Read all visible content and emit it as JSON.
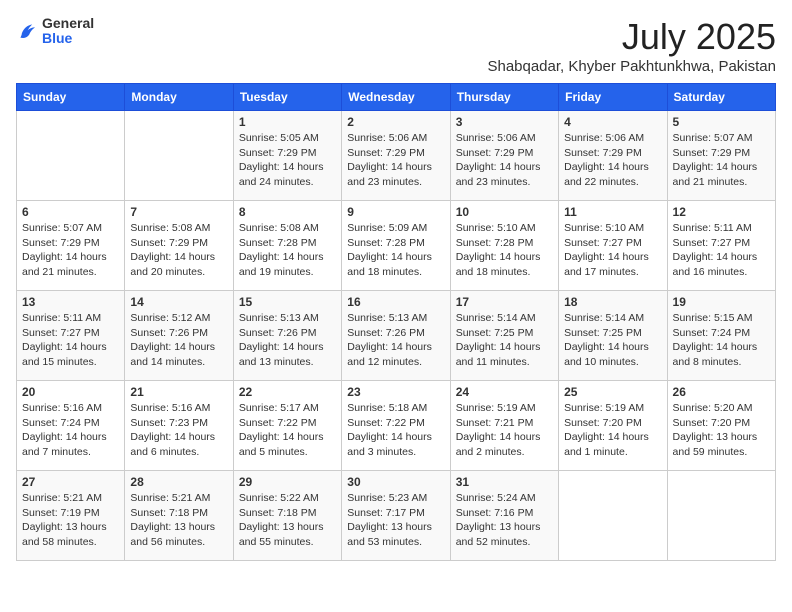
{
  "logo": {
    "general": "General",
    "blue": "Blue"
  },
  "header": {
    "month": "July 2025",
    "location": "Shabqadar, Khyber Pakhtunkhwa, Pakistan"
  },
  "weekdays": [
    "Sunday",
    "Monday",
    "Tuesday",
    "Wednesday",
    "Thursday",
    "Friday",
    "Saturday"
  ],
  "weeks": [
    [
      {
        "day": "",
        "sunrise": "",
        "sunset": "",
        "daylight": ""
      },
      {
        "day": "",
        "sunrise": "",
        "sunset": "",
        "daylight": ""
      },
      {
        "day": "1",
        "sunrise": "Sunrise: 5:05 AM",
        "sunset": "Sunset: 7:29 PM",
        "daylight": "Daylight: 14 hours and 24 minutes."
      },
      {
        "day": "2",
        "sunrise": "Sunrise: 5:06 AM",
        "sunset": "Sunset: 7:29 PM",
        "daylight": "Daylight: 14 hours and 23 minutes."
      },
      {
        "day": "3",
        "sunrise": "Sunrise: 5:06 AM",
        "sunset": "Sunset: 7:29 PM",
        "daylight": "Daylight: 14 hours and 23 minutes."
      },
      {
        "day": "4",
        "sunrise": "Sunrise: 5:06 AM",
        "sunset": "Sunset: 7:29 PM",
        "daylight": "Daylight: 14 hours and 22 minutes."
      },
      {
        "day": "5",
        "sunrise": "Sunrise: 5:07 AM",
        "sunset": "Sunset: 7:29 PM",
        "daylight": "Daylight: 14 hours and 21 minutes."
      }
    ],
    [
      {
        "day": "6",
        "sunrise": "Sunrise: 5:07 AM",
        "sunset": "Sunset: 7:29 PM",
        "daylight": "Daylight: 14 hours and 21 minutes."
      },
      {
        "day": "7",
        "sunrise": "Sunrise: 5:08 AM",
        "sunset": "Sunset: 7:29 PM",
        "daylight": "Daylight: 14 hours and 20 minutes."
      },
      {
        "day": "8",
        "sunrise": "Sunrise: 5:08 AM",
        "sunset": "Sunset: 7:28 PM",
        "daylight": "Daylight: 14 hours and 19 minutes."
      },
      {
        "day": "9",
        "sunrise": "Sunrise: 5:09 AM",
        "sunset": "Sunset: 7:28 PM",
        "daylight": "Daylight: 14 hours and 18 minutes."
      },
      {
        "day": "10",
        "sunrise": "Sunrise: 5:10 AM",
        "sunset": "Sunset: 7:28 PM",
        "daylight": "Daylight: 14 hours and 18 minutes."
      },
      {
        "day": "11",
        "sunrise": "Sunrise: 5:10 AM",
        "sunset": "Sunset: 7:27 PM",
        "daylight": "Daylight: 14 hours and 17 minutes."
      },
      {
        "day": "12",
        "sunrise": "Sunrise: 5:11 AM",
        "sunset": "Sunset: 7:27 PM",
        "daylight": "Daylight: 14 hours and 16 minutes."
      }
    ],
    [
      {
        "day": "13",
        "sunrise": "Sunrise: 5:11 AM",
        "sunset": "Sunset: 7:27 PM",
        "daylight": "Daylight: 14 hours and 15 minutes."
      },
      {
        "day": "14",
        "sunrise": "Sunrise: 5:12 AM",
        "sunset": "Sunset: 7:26 PM",
        "daylight": "Daylight: 14 hours and 14 minutes."
      },
      {
        "day": "15",
        "sunrise": "Sunrise: 5:13 AM",
        "sunset": "Sunset: 7:26 PM",
        "daylight": "Daylight: 14 hours and 13 minutes."
      },
      {
        "day": "16",
        "sunrise": "Sunrise: 5:13 AM",
        "sunset": "Sunset: 7:26 PM",
        "daylight": "Daylight: 14 hours and 12 minutes."
      },
      {
        "day": "17",
        "sunrise": "Sunrise: 5:14 AM",
        "sunset": "Sunset: 7:25 PM",
        "daylight": "Daylight: 14 hours and 11 minutes."
      },
      {
        "day": "18",
        "sunrise": "Sunrise: 5:14 AM",
        "sunset": "Sunset: 7:25 PM",
        "daylight": "Daylight: 14 hours and 10 minutes."
      },
      {
        "day": "19",
        "sunrise": "Sunrise: 5:15 AM",
        "sunset": "Sunset: 7:24 PM",
        "daylight": "Daylight: 14 hours and 8 minutes."
      }
    ],
    [
      {
        "day": "20",
        "sunrise": "Sunrise: 5:16 AM",
        "sunset": "Sunset: 7:24 PM",
        "daylight": "Daylight: 14 hours and 7 minutes."
      },
      {
        "day": "21",
        "sunrise": "Sunrise: 5:16 AM",
        "sunset": "Sunset: 7:23 PM",
        "daylight": "Daylight: 14 hours and 6 minutes."
      },
      {
        "day": "22",
        "sunrise": "Sunrise: 5:17 AM",
        "sunset": "Sunset: 7:22 PM",
        "daylight": "Daylight: 14 hours and 5 minutes."
      },
      {
        "day": "23",
        "sunrise": "Sunrise: 5:18 AM",
        "sunset": "Sunset: 7:22 PM",
        "daylight": "Daylight: 14 hours and 3 minutes."
      },
      {
        "day": "24",
        "sunrise": "Sunrise: 5:19 AM",
        "sunset": "Sunset: 7:21 PM",
        "daylight": "Daylight: 14 hours and 2 minutes."
      },
      {
        "day": "25",
        "sunrise": "Sunrise: 5:19 AM",
        "sunset": "Sunset: 7:20 PM",
        "daylight": "Daylight: 14 hours and 1 minute."
      },
      {
        "day": "26",
        "sunrise": "Sunrise: 5:20 AM",
        "sunset": "Sunset: 7:20 PM",
        "daylight": "Daylight: 13 hours and 59 minutes."
      }
    ],
    [
      {
        "day": "27",
        "sunrise": "Sunrise: 5:21 AM",
        "sunset": "Sunset: 7:19 PM",
        "daylight": "Daylight: 13 hours and 58 minutes."
      },
      {
        "day": "28",
        "sunrise": "Sunrise: 5:21 AM",
        "sunset": "Sunset: 7:18 PM",
        "daylight": "Daylight: 13 hours and 56 minutes."
      },
      {
        "day": "29",
        "sunrise": "Sunrise: 5:22 AM",
        "sunset": "Sunset: 7:18 PM",
        "daylight": "Daylight: 13 hours and 55 minutes."
      },
      {
        "day": "30",
        "sunrise": "Sunrise: 5:23 AM",
        "sunset": "Sunset: 7:17 PM",
        "daylight": "Daylight: 13 hours and 53 minutes."
      },
      {
        "day": "31",
        "sunrise": "Sunrise: 5:24 AM",
        "sunset": "Sunset: 7:16 PM",
        "daylight": "Daylight: 13 hours and 52 minutes."
      },
      {
        "day": "",
        "sunrise": "",
        "sunset": "",
        "daylight": ""
      },
      {
        "day": "",
        "sunrise": "",
        "sunset": "",
        "daylight": ""
      }
    ]
  ]
}
